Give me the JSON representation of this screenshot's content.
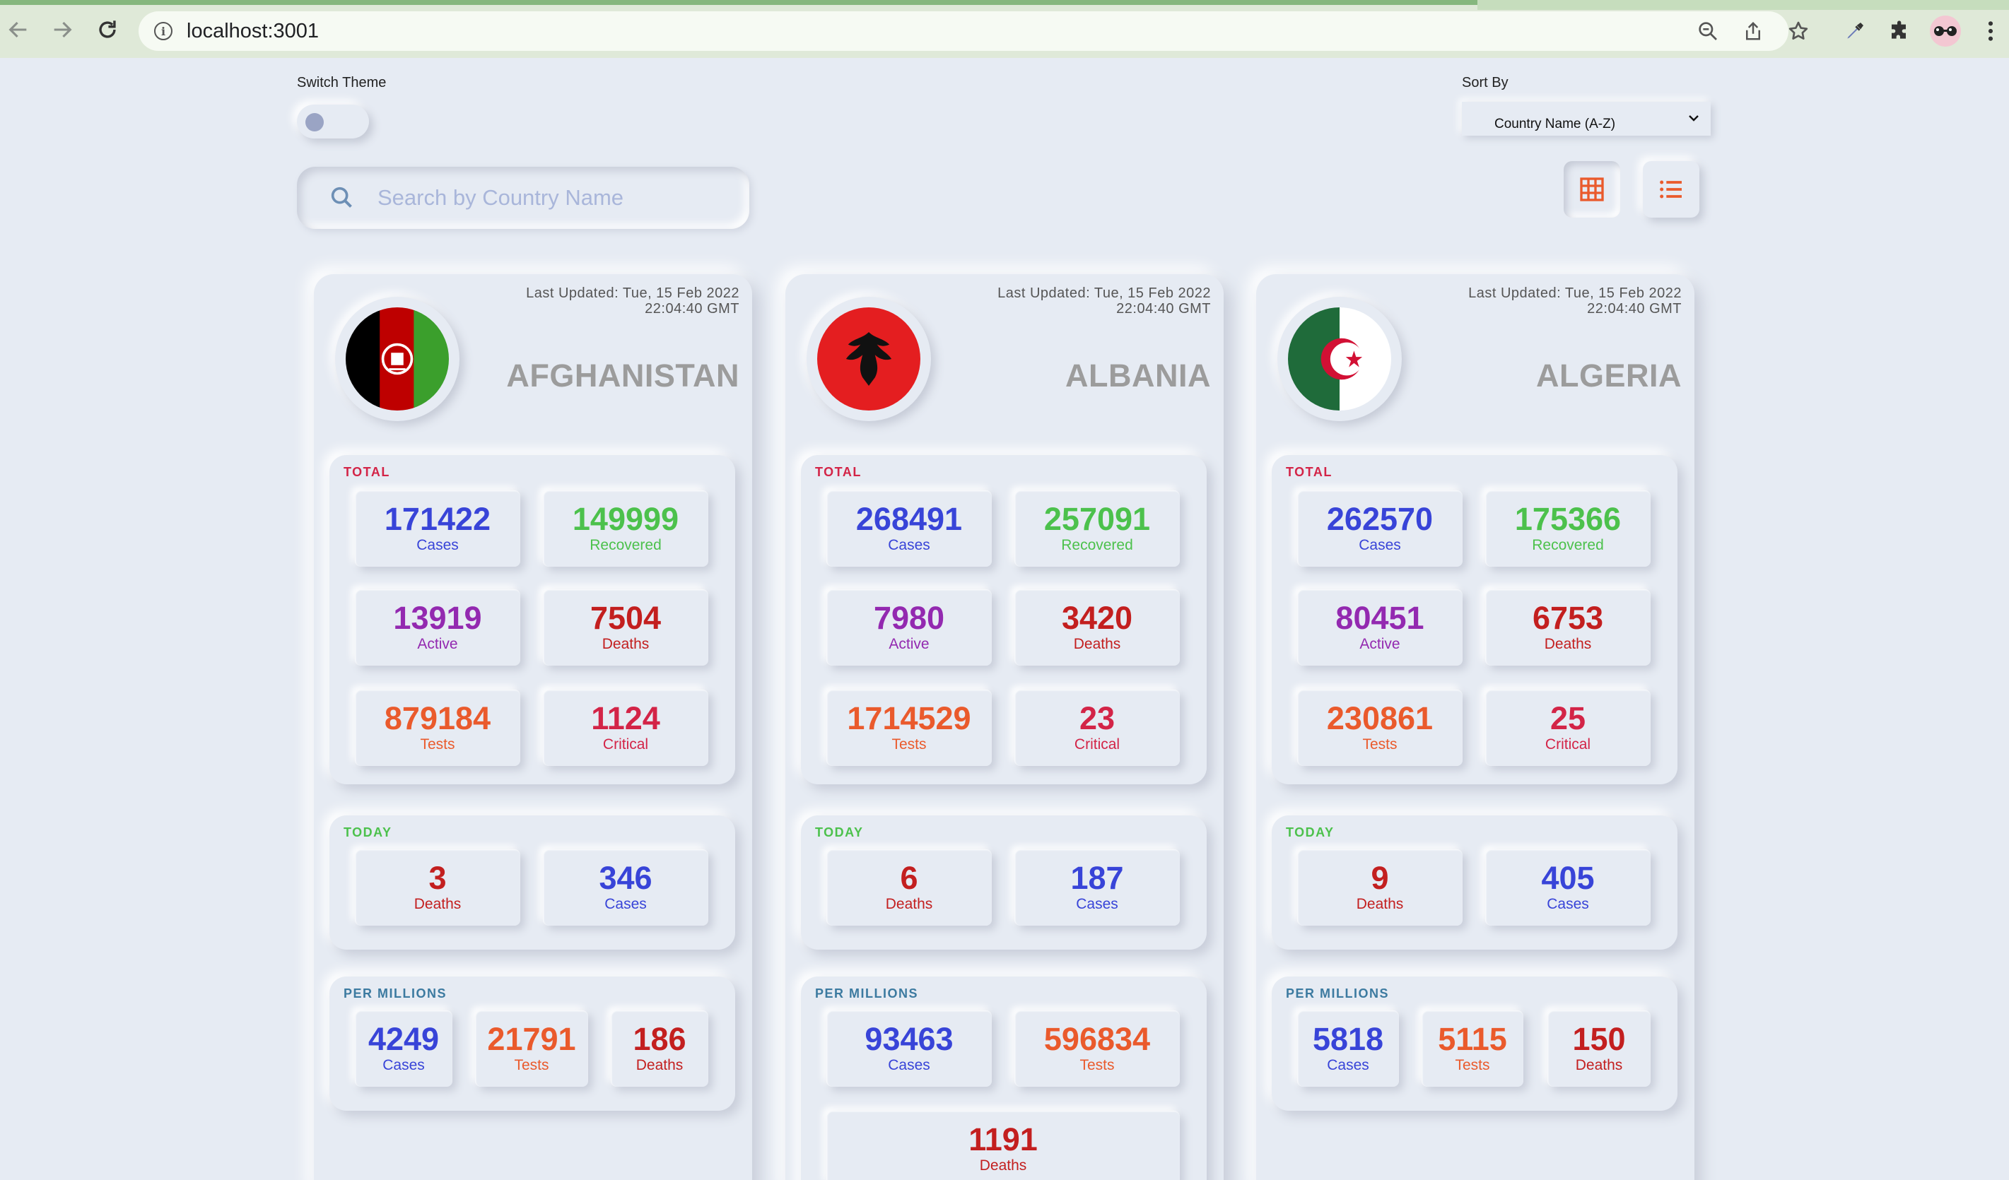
{
  "browser": {
    "url": "localhost:3001"
  },
  "controls": {
    "switch_theme_label": "Switch Theme",
    "sort_by_label": "Sort By",
    "sort_value": "Country Name (A-Z)",
    "search_placeholder": "Search by Country Name"
  },
  "sections": {
    "total": "TOTAL",
    "today": "TODAY",
    "per_millions": "PER MILLIONS"
  },
  "labels": {
    "cases": "Cases",
    "recovered": "Recovered",
    "active": "Active",
    "deaths": "Deaths",
    "tests": "Tests",
    "critical": "Critical"
  },
  "colors": {
    "background": "#e6ebf3",
    "accent": "#ea5a2c",
    "cases": "#3844d8",
    "recovered": "#4cc14c",
    "active": "#9329b0",
    "deaths": "#c31f1f",
    "tests": "#ea5a2c",
    "critical": "#d32447"
  },
  "icons": {
    "back": "arrow-left-icon",
    "forward": "arrow-right-icon",
    "reload": "reload-icon",
    "zoom": "zoom-icon",
    "share": "share-icon",
    "bookmark": "star-icon",
    "eyedropper": "eyedropper-icon",
    "extensions": "puzzle-icon",
    "menu": "kebab-menu-icon",
    "search": "search-icon",
    "grid_view": "grid-view-icon",
    "list_view": "list-view-icon"
  },
  "countries": [
    {
      "name": "AFGHANISTAN",
      "updated_line1": "Last Updated: Tue, 15 Feb 2022",
      "updated_line2": "22:04:40 GMT",
      "total": {
        "cases": "171422",
        "recovered": "149999",
        "active": "13919",
        "deaths": "7504",
        "tests": "879184",
        "critical": "1124"
      },
      "today": {
        "deaths": "3",
        "cases": "346"
      },
      "per_millions": {
        "cases": "4249",
        "tests": "21791",
        "deaths": "186"
      }
    },
    {
      "name": "ALBANIA",
      "updated_line1": "Last Updated: Tue, 15 Feb 2022",
      "updated_line2": "22:04:40 GMT",
      "total": {
        "cases": "268491",
        "recovered": "257091",
        "active": "7980",
        "deaths": "3420",
        "tests": "1714529",
        "critical": "23"
      },
      "today": {
        "deaths": "6",
        "cases": "187"
      },
      "per_millions": {
        "cases": "93463",
        "tests": "596834",
        "deaths": "1191"
      }
    },
    {
      "name": "ALGERIA",
      "updated_line1": "Last Updated: Tue, 15 Feb 2022",
      "updated_line2": "22:04:40 GMT",
      "total": {
        "cases": "262570",
        "recovered": "175366",
        "active": "80451",
        "deaths": "6753",
        "tests": "230861",
        "critical": "25"
      },
      "today": {
        "deaths": "9",
        "cases": "405"
      },
      "per_millions": {
        "cases": "5818",
        "tests": "5115",
        "deaths": "150"
      }
    }
  ]
}
